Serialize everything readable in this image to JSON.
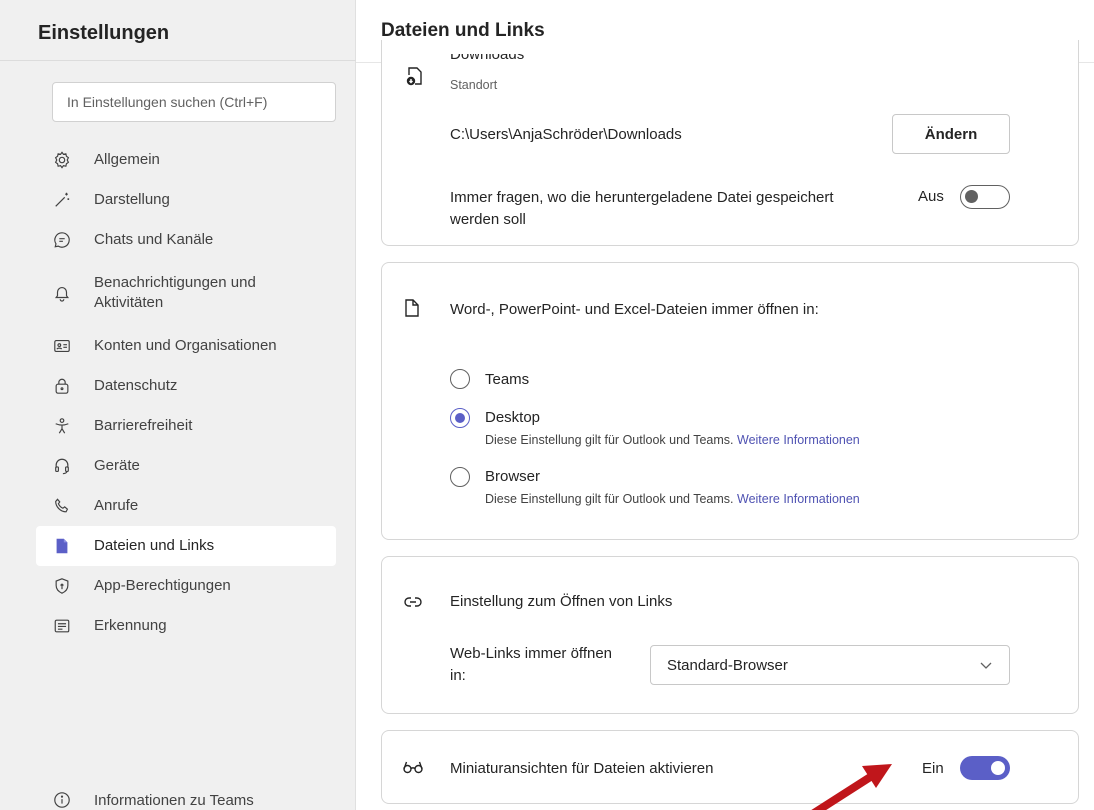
{
  "sidebar": {
    "title": "Einstellungen",
    "search_placeholder": "In Einstellungen suchen (Ctrl+F)",
    "items": [
      {
        "label": "Allgemein",
        "icon": "gear-icon"
      },
      {
        "label": "Darstellung",
        "icon": "magic-wand-icon"
      },
      {
        "label": "Chats und Kanäle",
        "icon": "chat-icon"
      },
      {
        "label": "Benachrichtigungen und Aktivitäten",
        "icon": "bell-icon"
      },
      {
        "label": "Konten und Organisationen",
        "icon": "contact-card-icon"
      },
      {
        "label": "Datenschutz",
        "icon": "lock-icon"
      },
      {
        "label": "Barrierefreiheit",
        "icon": "accessibility-icon"
      },
      {
        "label": "Geräte",
        "icon": "headset-icon"
      },
      {
        "label": "Anrufe",
        "icon": "phone-icon"
      },
      {
        "label": "Dateien und Links",
        "icon": "document-icon"
      },
      {
        "label": "App-Berechtigungen",
        "icon": "shield-icon"
      },
      {
        "label": "Erkennung",
        "icon": "text-box-icon"
      }
    ],
    "active_item": "Dateien und Links",
    "footer_label": "Informationen zu Teams"
  },
  "main": {
    "title": "Dateien und Links",
    "downloads": {
      "heading": "Downloads",
      "sublabel": "Standort",
      "path": "C:\\Users\\AnjaSchröder\\Downloads",
      "change_button": "Ändern",
      "ask_label_line1": "Immer fragen, wo die heruntergeladene Datei gespeichert",
      "ask_label_line2": "werden soll",
      "ask_state": "Aus"
    },
    "open_files": {
      "heading": "Word-, PowerPoint- und Excel-Dateien immer öffnen in:",
      "options": [
        {
          "label": "Teams",
          "hint": "",
          "link": "",
          "selected": false
        },
        {
          "label": "Desktop",
          "hint": "Diese Einstellung gilt für Outlook und Teams.",
          "link": "Weitere Informationen",
          "selected": true
        },
        {
          "label": "Browser",
          "hint": "Diese Einstellung gilt für Outlook und Teams.",
          "link": "Weitere Informationen",
          "selected": false
        }
      ]
    },
    "links": {
      "heading": "Einstellung zum Öffnen von Links",
      "web_links_label_line1": "Web-Links immer öffnen",
      "web_links_label_line2": "in:",
      "selected_value": "Standard-Browser"
    },
    "thumbnails": {
      "label": "Miniaturansichten für Dateien aktivieren",
      "state": "Ein"
    }
  },
  "colors": {
    "accent": "#5b5fc7",
    "link": "#4f52b2",
    "annotation_arrow": "#c0161b"
  }
}
